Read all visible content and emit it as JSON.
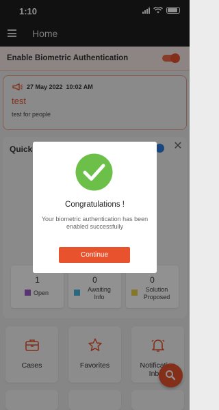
{
  "status_bar": {
    "time": "1:10"
  },
  "app_bar": {
    "title": "Home"
  },
  "biometric": {
    "label": "Enable Biometric Authentication",
    "enabled": true
  },
  "announcement": {
    "date": "27 May 2022",
    "time": "10:02 AM",
    "datetime": "27 May 2022  10:02 AM",
    "title": "test",
    "body": "test for people"
  },
  "quick": {
    "title": "Quick",
    "stats": [
      {
        "count": "1",
        "label": "Open",
        "color": "#9c5ec9"
      },
      {
        "count": "0",
        "label": "Awaiting\nInfo",
        "color": "#4db8e0"
      },
      {
        "count": "0",
        "label": "Solution\nProposed",
        "color": "#ead24b"
      }
    ]
  },
  "tiles": [
    {
      "label": "Cases",
      "icon": "briefcase-icon"
    },
    {
      "label": "Favorites",
      "icon": "star-icon"
    },
    {
      "label": "Notification\nInbox",
      "icon": "bell-icon"
    }
  ],
  "dialog": {
    "title": "Congratulations !",
    "message": "Your biometric authentication has been enabled successfully",
    "button": "Continue"
  },
  "colors": {
    "accent": "#e8532e",
    "success": "#6cc04a",
    "app_bar": "#1e1e1e"
  }
}
